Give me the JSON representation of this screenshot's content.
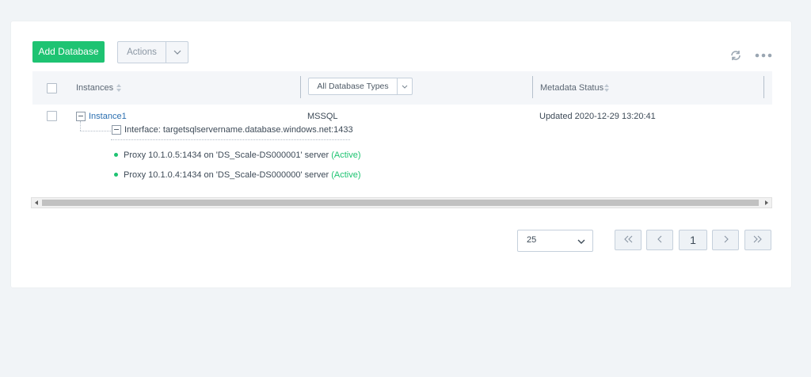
{
  "toolbar": {
    "add_label": "Add Database",
    "actions_label": "Actions"
  },
  "table": {
    "headers": {
      "instances": "Instances",
      "type_filter": "All Database Types",
      "metadata": "Metadata Status"
    },
    "rows": [
      {
        "name": "Instance1",
        "type": "MSSQL",
        "status": "Updated 2020-12-29 13:20:41",
        "interface": "Interface: targetsqlservername.database.windows.net:1433",
        "proxies": [
          {
            "text": "Proxy 10.1.0.5:1434 on 'DS_Scale-DS000001' server",
            "state": "(Active)"
          },
          {
            "text": "Proxy 10.1.0.4:1434 on 'DS_Scale-DS000000' server",
            "state": "(Active)"
          }
        ]
      }
    ]
  },
  "pagination": {
    "page_size": "25",
    "current_page": "1"
  },
  "colors": {
    "accent": "#1ec372",
    "link": "#2b6fb0",
    "background": "#f1f4f7"
  },
  "icons": [
    "refresh-icon",
    "more-icon",
    "chevron-down-icon",
    "sort-icon",
    "first-page-icon",
    "prev-page-icon",
    "next-page-icon",
    "last-page-icon"
  ]
}
